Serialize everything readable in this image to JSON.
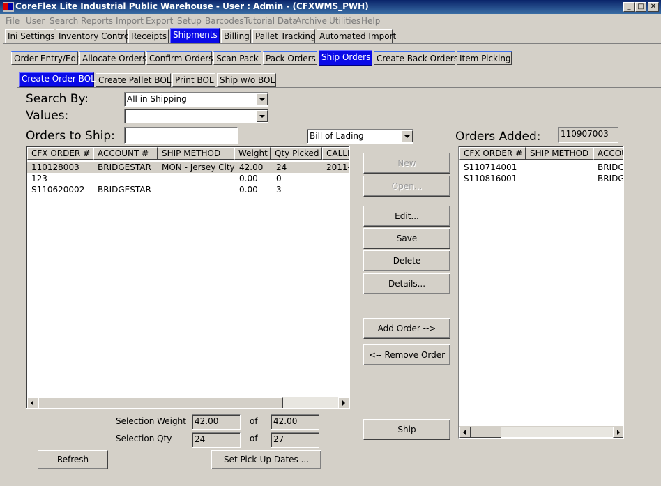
{
  "window": {
    "title": "CoreFlex Lite Industrial Public Warehouse - User : Admin - (CFXWMS_PWH)",
    "minimize": "_",
    "maximize": "□",
    "close": "✕"
  },
  "menu": [
    "File",
    "User",
    "Search",
    "Reports",
    "Import",
    "Export",
    "Setup",
    "Barcodes",
    "Tutorial Data",
    "Archive",
    "Utilities",
    "Help"
  ],
  "main_tabs": [
    "Ini Settings",
    "Inventory Control",
    "Receipts",
    "Shipments",
    "Billing",
    "Pallet Tracking",
    "Automated Import"
  ],
  "main_tab_active": "Shipments",
  "sub_tabs": [
    "Order Entry/Edit",
    "Allocate Orders",
    "Confirm Orders",
    "Scan Pack",
    "Pack Orders",
    "Ship Orders",
    "Create Back Orders",
    "Item Picking"
  ],
  "sub_tab_active": "Ship Orders",
  "bol_tabs": [
    "Create Order BOL",
    "Create Pallet BOL",
    "Print BOL",
    "Ship w/o BOL"
  ],
  "bol_tab_active": "Create Order BOL",
  "search": {
    "search_by_label": "Search By:",
    "search_by_value": "All in Shipping",
    "values_label": "Values:",
    "values_value": ""
  },
  "orders_to_ship": {
    "label": "Orders to Ship:",
    "input_value": "",
    "type_value": "Bill of Lading",
    "columns": [
      "CFX ORDER #",
      "ACCOUNT #",
      "SHIP METHOD",
      "Weight",
      "Qty Picked",
      "CALLE"
    ],
    "rows": [
      {
        "order": "110128003",
        "account": "BRIDGESTAR",
        "ship_method": "MON - Jersey City",
        "weight": "42.00",
        "qty": "24",
        "called": "2011-"
      },
      {
        "order": "123",
        "account": "",
        "ship_method": "",
        "weight": "0.00",
        "qty": "0",
        "called": ""
      },
      {
        "order": "S110620002",
        "account": "BRIDGESTAR",
        "ship_method": "",
        "weight": "0.00",
        "qty": "3",
        "called": ""
      }
    ]
  },
  "orders_added": {
    "label": "Orders Added:",
    "value": "110907003",
    "columns": [
      "CFX ORDER #",
      "SHIP METHOD",
      "ACCOU"
    ],
    "rows": [
      {
        "order": "S110714001",
        "ship_method": "",
        "account": "BRIDG"
      },
      {
        "order": "S110816001",
        "ship_method": "",
        "account": "BRIDG"
      }
    ]
  },
  "buttons": {
    "new": "New",
    "open": "Open...",
    "edit": "Edit...",
    "save": "Save",
    "delete": "Delete",
    "details": "Details...",
    "add_order": "Add Order -->",
    "remove_order": "<-- Remove Order",
    "ship": "Ship",
    "refresh": "Refresh",
    "set_pickup": "Set Pick-Up Dates ..."
  },
  "totals": {
    "weight_label": "Selection Weight",
    "weight_value": "42.00",
    "weight_total": "42.00",
    "qty_label": "Selection Qty",
    "qty_value": "24",
    "qty_total": "27",
    "of_label": "of"
  }
}
